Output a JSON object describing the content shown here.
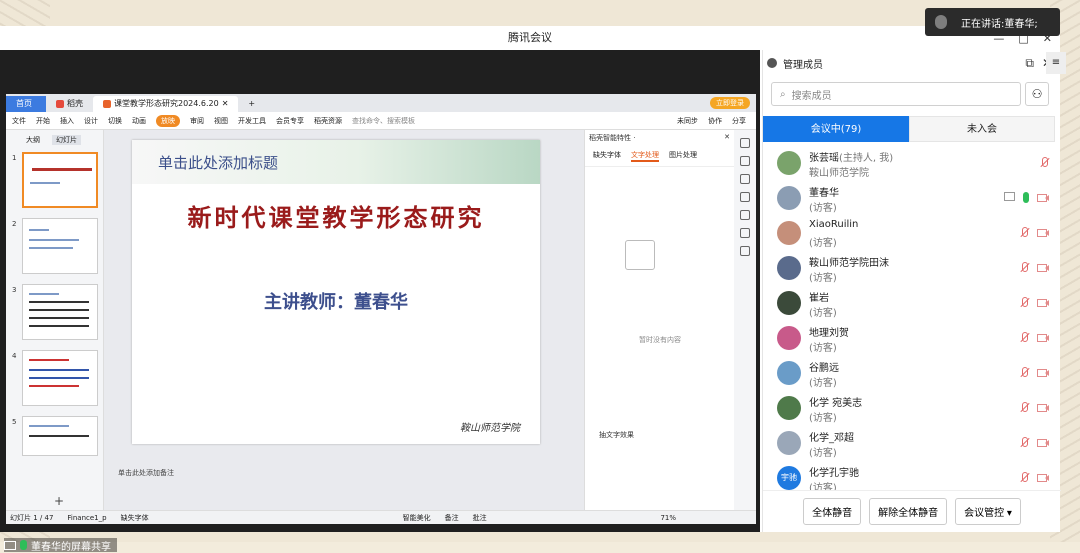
{
  "app": {
    "title": "腾讯会议"
  },
  "speaker": {
    "prefix": "正在讲话: ",
    "name": "董春华;"
  },
  "wps": {
    "tabs": [
      {
        "label": "首页"
      },
      {
        "label": "稻壳"
      },
      {
        "label": "课堂教学形态研究2024.6.20"
      }
    ],
    "login": "立即登录",
    "menus": [
      "文件",
      "开始",
      "插入",
      "设计",
      "切换",
      "动画",
      "放映",
      "审阅",
      "视图",
      "开发工具",
      "会员专享",
      "稻壳资源"
    ],
    "search_placeholder": "查找命令、搜索模板",
    "right_menu": [
      "未同步",
      "协作",
      "分享"
    ],
    "thumb_tabs": [
      "大纲",
      "幻灯片"
    ],
    "thumb_numbers": [
      "1",
      "2",
      "3",
      "4",
      "5"
    ],
    "slide": {
      "banner_title": "单击此处添加标题",
      "main_title": "新时代课堂教学形态研究",
      "subtitle": "主讲教师：董春华",
      "signature": "鞍山师范学院"
    },
    "notes": "单击此处添加备注",
    "side_panel": {
      "title": "稻壳智能特性 ·",
      "tabs": [
        "缺失字体",
        "文字处理",
        "图片处理"
      ],
      "empty_icon_text": "暂时没有内容",
      "empty_text": "暂时没有内容",
      "extract": "抽文字效果"
    },
    "status": {
      "slide_count": "幻灯片 1 / 47",
      "theme": "Finance1_p",
      "missing_font": "缺失字体",
      "beautify": "智能美化",
      "notes": "备注",
      "comments": "批注",
      "zoom": "71%"
    }
  },
  "share_label": "董春华的屏幕共享",
  "members_panel": {
    "title": "管理成员",
    "search_placeholder": "搜索成员",
    "tabs": [
      {
        "label": "会议中(79)"
      },
      {
        "label": "未入会"
      }
    ],
    "list": [
      {
        "name": "张芸瑶",
        "tag": "(主持人, 我)",
        "role": "鞍山师范学院",
        "avatar_color": "#7aa36b",
        "mic": "off",
        "screen": false
      },
      {
        "name": "董春华",
        "tag": "",
        "role": "(访客)",
        "avatar_color": "#8b9db3",
        "mic": "on",
        "screen": true
      },
      {
        "name": "XiaoRuilin",
        "tag": "",
        "role": "(访客)",
        "avatar_color": "#c58f7a",
        "mic": "off",
        "screen": false
      },
      {
        "name": "鞍山师范学院田沫",
        "tag": "",
        "role": "(访客)",
        "avatar_color": "#5a6b8c",
        "mic": "off",
        "screen": false
      },
      {
        "name": "崔岩",
        "tag": "",
        "role": "(访客)",
        "avatar_color": "#3b4a3a",
        "mic": "off",
        "screen": false
      },
      {
        "name": "地理刘贺",
        "tag": "",
        "role": "(访客)",
        "avatar_color": "#c85a8a",
        "mic": "off",
        "screen": false
      },
      {
        "name": "谷鹏远",
        "tag": "",
        "role": "(访客)",
        "avatar_color": "#6a9cc8",
        "mic": "off",
        "screen": false
      },
      {
        "name": "化学 宛美志",
        "tag": "",
        "role": "(访客)",
        "avatar_color": "#4f7a4a",
        "mic": "off",
        "screen": false
      },
      {
        "name": "化学_邓超",
        "tag": "",
        "role": "(访客)",
        "avatar_color": "#9aa7b8",
        "mic": "off",
        "screen": false
      },
      {
        "name": "化学孔宇驰",
        "tag": "",
        "role": "(访客)",
        "avatar_color": "#1f7ae0",
        "avatar_text": "宇驰",
        "mic": "off",
        "screen": false
      }
    ],
    "buttons": {
      "mute_all": "全体静音",
      "unmute_all": "解除全体静音",
      "control": "会议管控"
    }
  }
}
